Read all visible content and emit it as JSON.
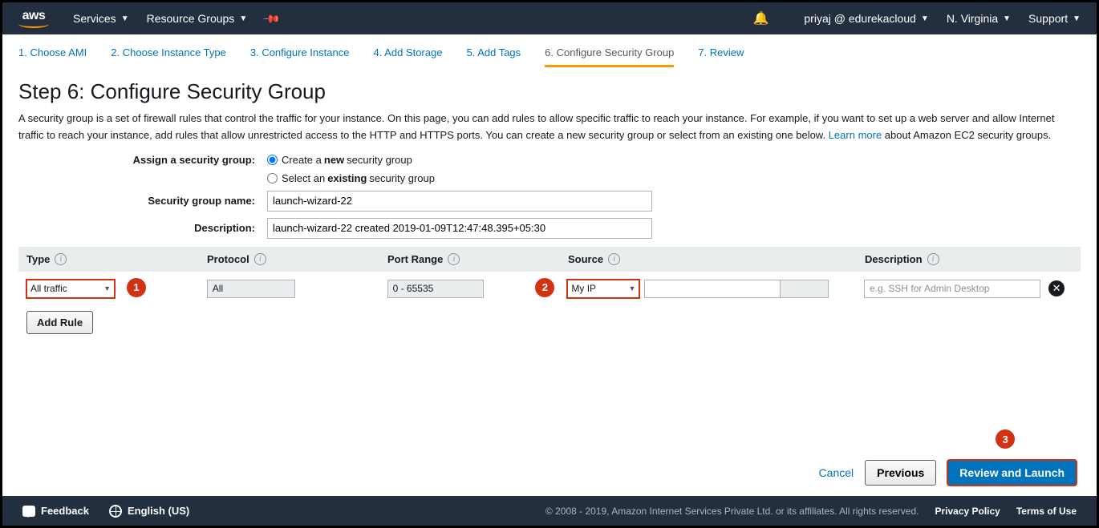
{
  "header": {
    "logo": "aws",
    "services": "Services",
    "resource_groups": "Resource Groups",
    "account": "priyaj @ edurekacloud",
    "region": "N. Virginia",
    "support": "Support"
  },
  "tabs": [
    "1. Choose AMI",
    "2. Choose Instance Type",
    "3. Configure Instance",
    "4. Add Storage",
    "5. Add Tags",
    "6. Configure Security Group",
    "7. Review"
  ],
  "page": {
    "title": "Step 6: Configure Security Group",
    "desc_before": "A security group is a set of firewall rules that control the traffic for your instance. On this page, you can add rules to allow specific traffic to reach your instance. For example, if you want to set up a web server and allow Internet traffic to reach your instance, add rules that allow unrestricted access to the HTTP and HTTPS ports. You can create a new security group or select from an existing one below. ",
    "learn_more": "Learn more",
    "desc_after": " about Amazon EC2 security groups."
  },
  "form": {
    "assign_label": "Assign a security group:",
    "radio_new_pre": "Create a ",
    "radio_new_bold": "new",
    "radio_new_post": " security group",
    "radio_existing_pre": "Select an ",
    "radio_existing_bold": "existing",
    "radio_existing_post": " security group",
    "name_label": "Security group name:",
    "name_value": "launch-wizard-22",
    "desc_label": "Description:",
    "desc_value": "launch-wizard-22 created 2019-01-09T12:47:48.395+05:30"
  },
  "columns": {
    "type": "Type",
    "protocol": "Protocol",
    "port": "Port Range",
    "source": "Source",
    "description": "Description"
  },
  "rule": {
    "type": "All traffic",
    "protocol": "All",
    "port": "0 - 65535",
    "source_select": "My IP",
    "source_ip": "",
    "description_placeholder": "e.g. SSH for Admin Desktop"
  },
  "buttons": {
    "add_rule": "Add Rule",
    "cancel": "Cancel",
    "previous": "Previous",
    "review_launch": "Review and Launch"
  },
  "callouts": {
    "one": "1",
    "two": "2",
    "three": "3"
  },
  "footer": {
    "feedback": "Feedback",
    "language": "English (US)",
    "copyright": "© 2008 - 2019, Amazon Internet Services Private Ltd. or its affiliates. All rights reserved.",
    "privacy": "Privacy Policy",
    "terms": "Terms of Use"
  }
}
